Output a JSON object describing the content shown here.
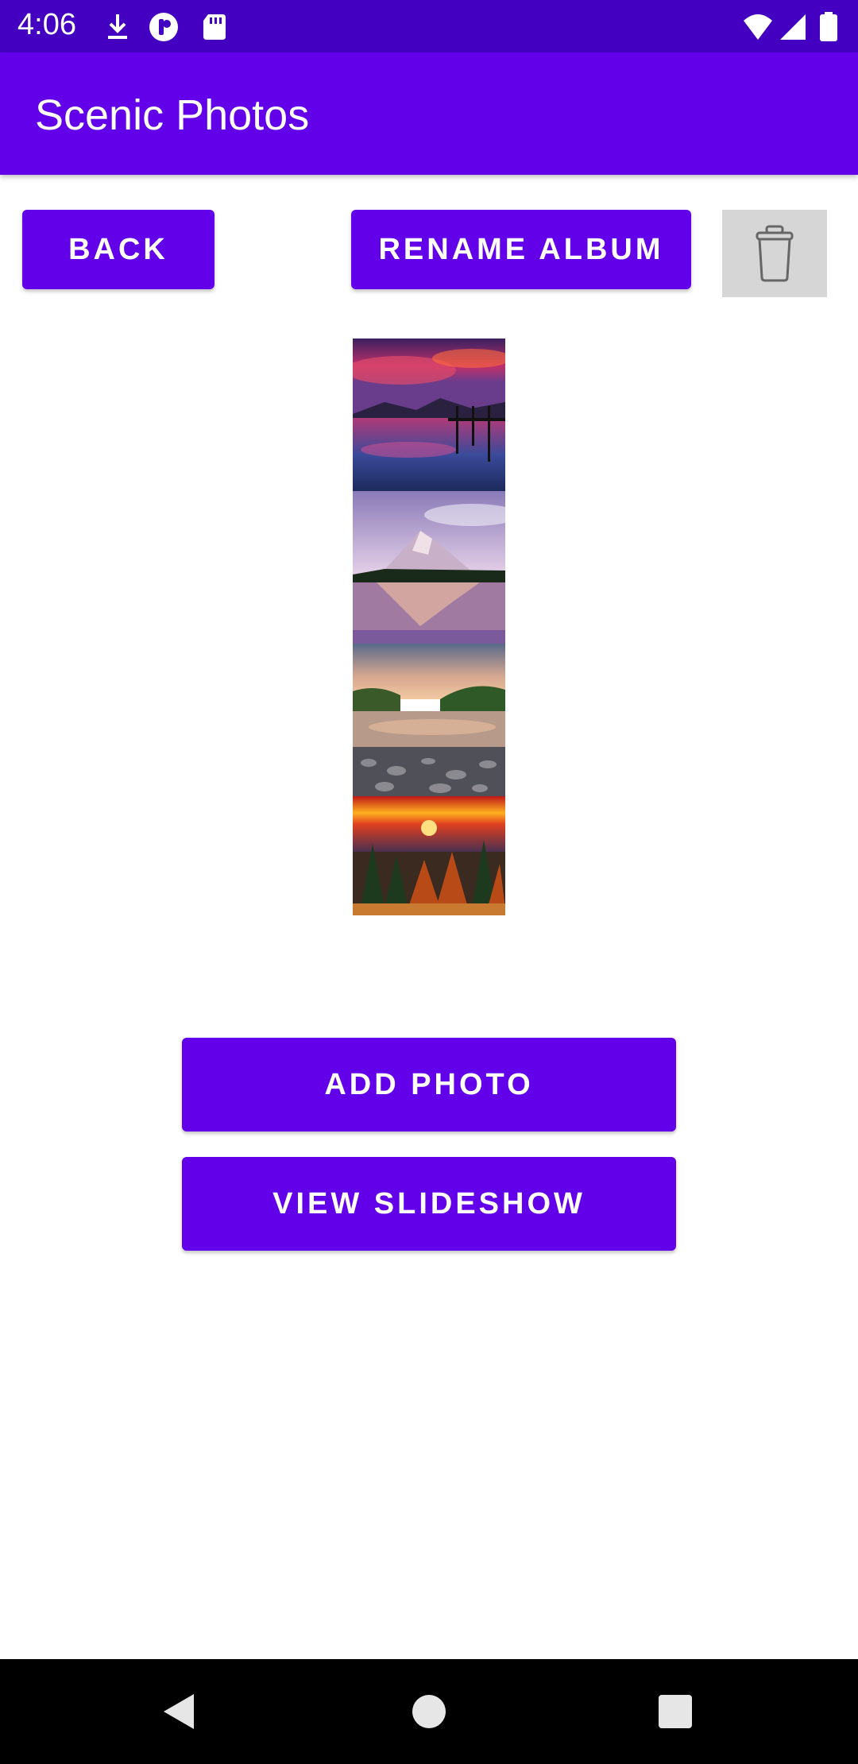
{
  "status_bar": {
    "time": "4:06",
    "icons": [
      "download-icon",
      "pocket-icon",
      "sd-card-icon",
      "wifi-icon",
      "signal-icon",
      "battery-icon"
    ]
  },
  "app_bar": {
    "title": "Scenic Photos"
  },
  "toolbar": {
    "back_label": "BACK",
    "rename_label": "RENAME ALBUM",
    "delete_icon": "trash-icon"
  },
  "photos": [
    {
      "name": "photo-lake-pier-sunset"
    },
    {
      "name": "photo-mountain-reflection"
    },
    {
      "name": "photo-river-rocks"
    },
    {
      "name": "photo-forest-sunset"
    }
  ],
  "actions": {
    "add_photo_label": "ADD PHOTO",
    "view_slideshow_label": "VIEW SLIDESHOW"
  },
  "nav_bar": {
    "icons": [
      "back-nav-icon",
      "home-nav-icon",
      "recents-nav-icon"
    ]
  },
  "colors": {
    "primary": "#6200ea",
    "status_bar": "#4400c0",
    "delete_bg": "#d6d6d6"
  }
}
